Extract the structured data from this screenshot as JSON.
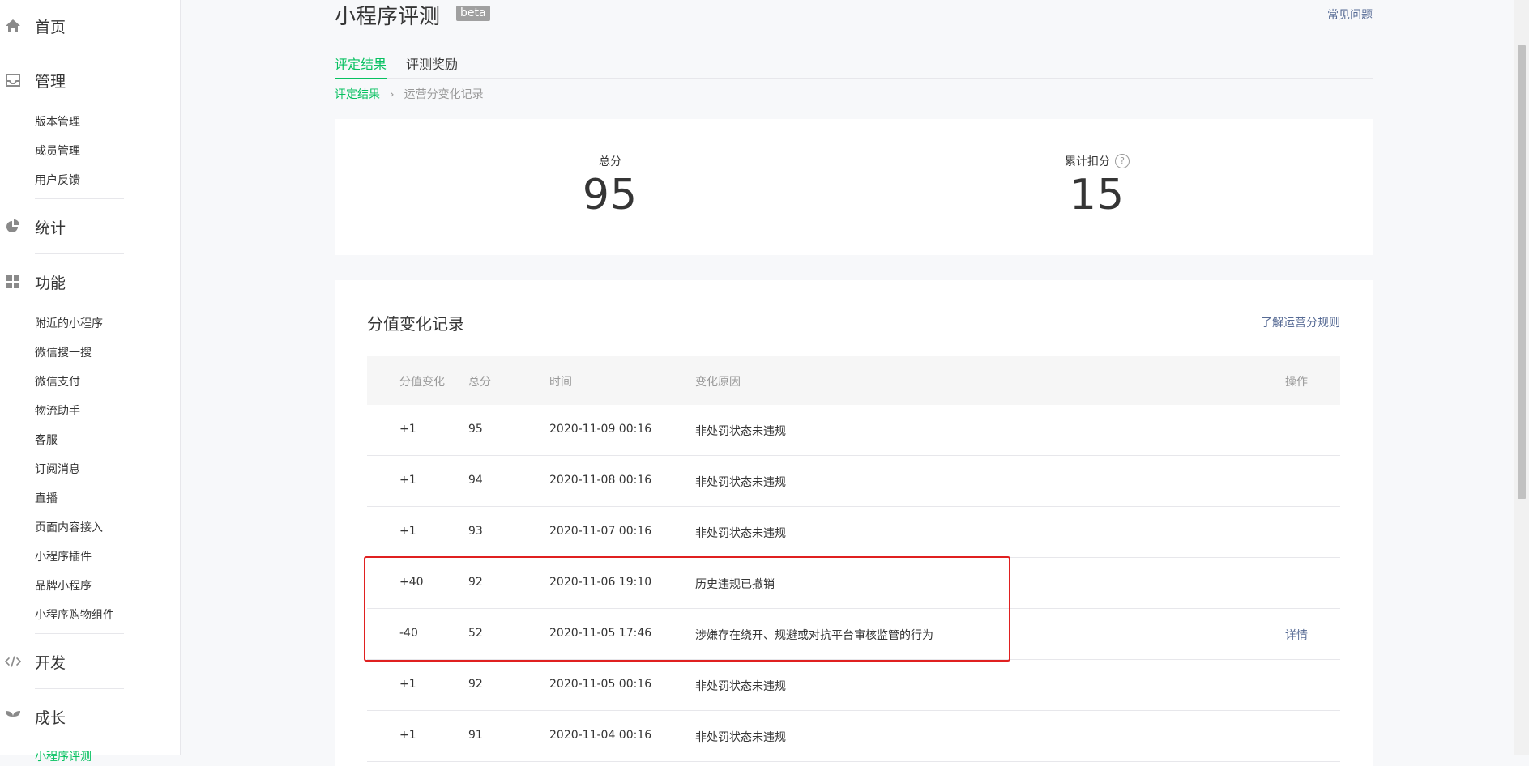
{
  "sidebar": {
    "home": "首页",
    "manage": "管理",
    "manage_items": [
      "版本管理",
      "成员管理",
      "用户反馈"
    ],
    "stats": "统计",
    "features": "功能",
    "feature_items": [
      "附近的小程序",
      "微信搜一搜",
      "微信支付",
      "物流助手",
      "客服",
      "订阅消息",
      "直播",
      "页面内容接入",
      "小程序插件",
      "品牌小程序",
      "小程序购物组件"
    ],
    "develop": "开发",
    "growth": "成长",
    "growth_items": [
      "小程序评测"
    ]
  },
  "header": {
    "title": "小程序评测",
    "badge": "beta",
    "faq": "常见问题"
  },
  "tabs": [
    "评定结果",
    "评测奖励"
  ],
  "breadcrumb": {
    "parent": "评定结果",
    "separator": "›",
    "current": "运营分变化记录"
  },
  "score": {
    "total_label": "总分",
    "total_value": "95",
    "deduct_label": "累计扣分",
    "deduct_value": "15"
  },
  "records": {
    "title": "分值变化记录",
    "rules_link": "了解运营分规则",
    "columns": [
      "分值变化",
      "总分",
      "时间",
      "变化原因",
      "操作"
    ],
    "rows": [
      {
        "change": "+1",
        "total": "95",
        "time": "2020-11-09 00:16",
        "reason": "非处罚状态未违规",
        "action": ""
      },
      {
        "change": "+1",
        "total": "94",
        "time": "2020-11-08 00:16",
        "reason": "非处罚状态未违规",
        "action": ""
      },
      {
        "change": "+1",
        "total": "93",
        "time": "2020-11-07 00:16",
        "reason": "非处罚状态未违规",
        "action": ""
      },
      {
        "change": "+40",
        "total": "92",
        "time": "2020-11-06 19:10",
        "reason": "历史违规已撤销",
        "action": ""
      },
      {
        "change": "-40",
        "total": "52",
        "time": "2020-11-05 17:46",
        "reason": "涉嫌存在绕开、规避或对抗平台审核监管的行为",
        "action": "详情"
      },
      {
        "change": "+1",
        "total": "92",
        "time": "2020-11-05 00:16",
        "reason": "非处罚状态未违规",
        "action": ""
      },
      {
        "change": "+1",
        "total": "91",
        "time": "2020-11-04 00:16",
        "reason": "非处罚状态未违规",
        "action": ""
      }
    ]
  },
  "colors": {
    "accent": "#07c160",
    "link": "#576b95",
    "highlight": "#e02020"
  },
  "icons": {
    "home": "home-icon",
    "manage": "inbox-icon",
    "stats": "pie-chart-icon",
    "features": "grid-icon",
    "develop": "code-icon",
    "growth": "sprout-icon",
    "help": "question-circle-icon"
  }
}
